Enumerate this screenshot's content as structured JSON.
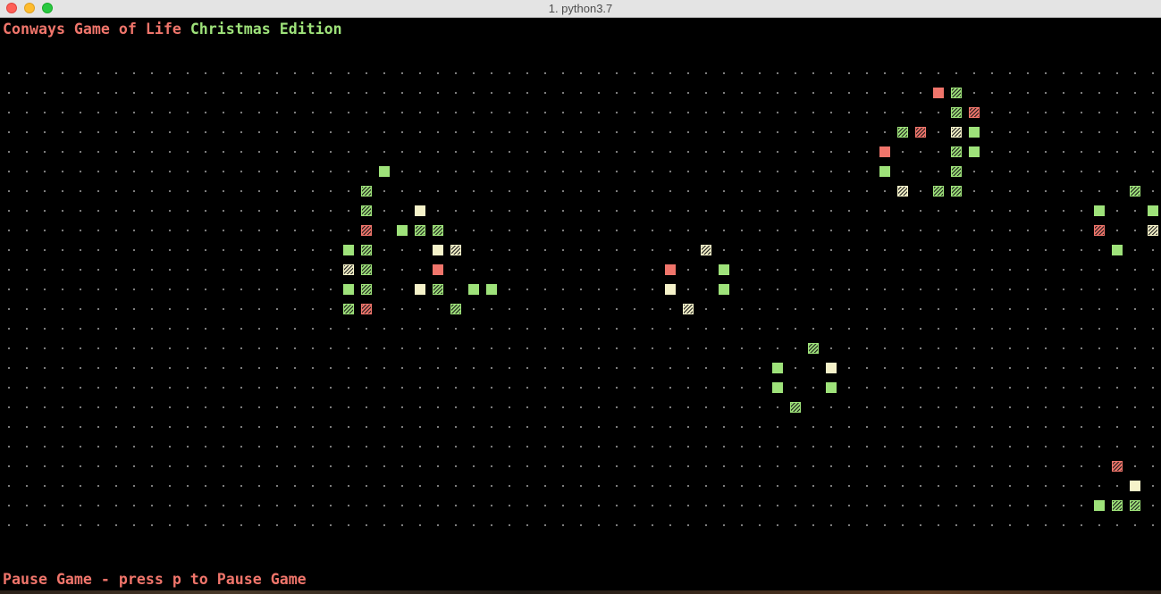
{
  "window": {
    "title": "1. python3.7"
  },
  "header": {
    "title_part1": "Conways Game of Life",
    "title_part2": "Christmas Edition"
  },
  "footer": {
    "status_text": "Pause Game - press p to Pause Game"
  },
  "colors": {
    "red": "#f0756b",
    "green": "#9ee27a",
    "cream": "#f5f2c9",
    "dot": "#8a8a8a",
    "background": "#000000"
  },
  "board": {
    "columns": 65,
    "rows": 24,
    "cell_color_legend": {
      "r": "red",
      "g": "green",
      "c": "cream"
    },
    "cells_columns_note": "cells listed as [row, col, color, hatched]",
    "cells": [
      [
        1,
        52,
        "r",
        false
      ],
      [
        1,
        53,
        "g",
        true
      ],
      [
        2,
        53,
        "g",
        true
      ],
      [
        2,
        54,
        "r",
        true
      ],
      [
        3,
        50,
        "g",
        true
      ],
      [
        3,
        51,
        "r",
        true
      ],
      [
        3,
        53,
        "c",
        true
      ],
      [
        3,
        54,
        "g",
        false
      ],
      [
        4,
        49,
        "r",
        false
      ],
      [
        4,
        53,
        "g",
        true
      ],
      [
        4,
        54,
        "g",
        false
      ],
      [
        5,
        21,
        "g",
        false
      ],
      [
        5,
        49,
        "g",
        false
      ],
      [
        5,
        53,
        "g",
        true
      ],
      [
        6,
        20,
        "g",
        true
      ],
      [
        6,
        50,
        "c",
        true
      ],
      [
        6,
        52,
        "g",
        true
      ],
      [
        6,
        53,
        "g",
        true
      ],
      [
        6,
        63,
        "g",
        true
      ],
      [
        7,
        20,
        "g",
        true
      ],
      [
        7,
        23,
        "c",
        false
      ],
      [
        7,
        61,
        "g",
        false
      ],
      [
        7,
        64,
        "g",
        false
      ],
      [
        8,
        20,
        "r",
        true
      ],
      [
        8,
        22,
        "g",
        false
      ],
      [
        8,
        23,
        "g",
        true
      ],
      [
        8,
        24,
        "g",
        true
      ],
      [
        8,
        61,
        "r",
        true
      ],
      [
        8,
        64,
        "c",
        true
      ],
      [
        9,
        19,
        "g",
        false
      ],
      [
        9,
        20,
        "g",
        true
      ],
      [
        9,
        24,
        "c",
        false
      ],
      [
        9,
        25,
        "c",
        true
      ],
      [
        9,
        39,
        "c",
        true
      ],
      [
        9,
        62,
        "g",
        false
      ],
      [
        10,
        19,
        "c",
        true
      ],
      [
        10,
        20,
        "g",
        true
      ],
      [
        10,
        24,
        "r",
        false
      ],
      [
        10,
        37,
        "r",
        false
      ],
      [
        10,
        40,
        "g",
        false
      ],
      [
        11,
        19,
        "g",
        false
      ],
      [
        11,
        20,
        "g",
        true
      ],
      [
        11,
        23,
        "c",
        false
      ],
      [
        11,
        24,
        "g",
        true
      ],
      [
        11,
        26,
        "g",
        false
      ],
      [
        11,
        27,
        "g",
        false
      ],
      [
        11,
        37,
        "c",
        false
      ],
      [
        11,
        40,
        "g",
        false
      ],
      [
        12,
        19,
        "g",
        true
      ],
      [
        12,
        20,
        "r",
        true
      ],
      [
        12,
        25,
        "g",
        true
      ],
      [
        12,
        38,
        "c",
        true
      ],
      [
        14,
        45,
        "g",
        true
      ],
      [
        15,
        43,
        "g",
        false
      ],
      [
        15,
        46,
        "c",
        false
      ],
      [
        16,
        43,
        "g",
        false
      ],
      [
        16,
        46,
        "g",
        false
      ],
      [
        17,
        44,
        "g",
        true
      ],
      [
        20,
        62,
        "r",
        true
      ],
      [
        21,
        63,
        "c",
        false
      ],
      [
        22,
        61,
        "g",
        false
      ],
      [
        22,
        62,
        "g",
        true
      ],
      [
        22,
        63,
        "g",
        true
      ]
    ]
  }
}
